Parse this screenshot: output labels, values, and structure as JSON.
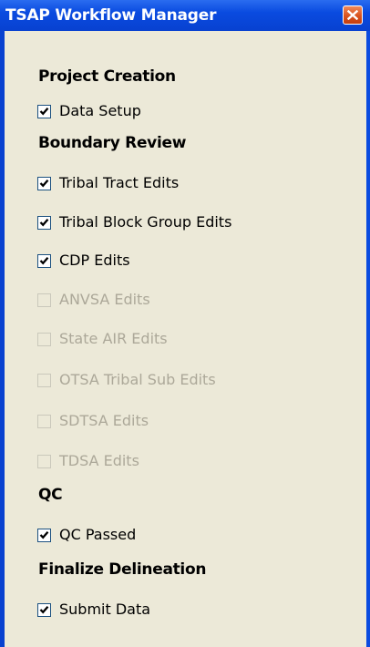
{
  "window": {
    "title": "TSAP Workflow Manager",
    "close_icon": "close-icon"
  },
  "sections": [
    {
      "heading": "Project Creation",
      "items": [
        {
          "label": "Data Setup",
          "checked": true,
          "enabled": true
        }
      ]
    },
    {
      "heading": "Boundary Review",
      "items": [
        {
          "label": "Tribal Tract Edits",
          "checked": true,
          "enabled": true
        },
        {
          "label": "Tribal Block Group Edits",
          "checked": true,
          "enabled": true
        },
        {
          "label": "CDP Edits",
          "checked": true,
          "enabled": true
        },
        {
          "label": "ANVSA Edits",
          "checked": false,
          "enabled": false
        },
        {
          "label": "State AIR Edits",
          "checked": false,
          "enabled": false
        },
        {
          "label": "OTSA Tribal Sub Edits",
          "checked": false,
          "enabled": false
        },
        {
          "label": "SDTSA Edits",
          "checked": false,
          "enabled": false
        },
        {
          "label": "TDSA Edits",
          "checked": false,
          "enabled": false
        }
      ]
    },
    {
      "heading": "QC",
      "items": [
        {
          "label": "QC Passed",
          "checked": true,
          "enabled": true
        }
      ]
    },
    {
      "heading": "Finalize Delineation",
      "items": [
        {
          "label": "Submit Data",
          "checked": true,
          "enabled": true
        }
      ]
    }
  ],
  "colors": {
    "titlebar": "#0a4be0",
    "panel": "#ece9d8",
    "close_button": "#d9531e",
    "disabled_text": "#aca899"
  }
}
